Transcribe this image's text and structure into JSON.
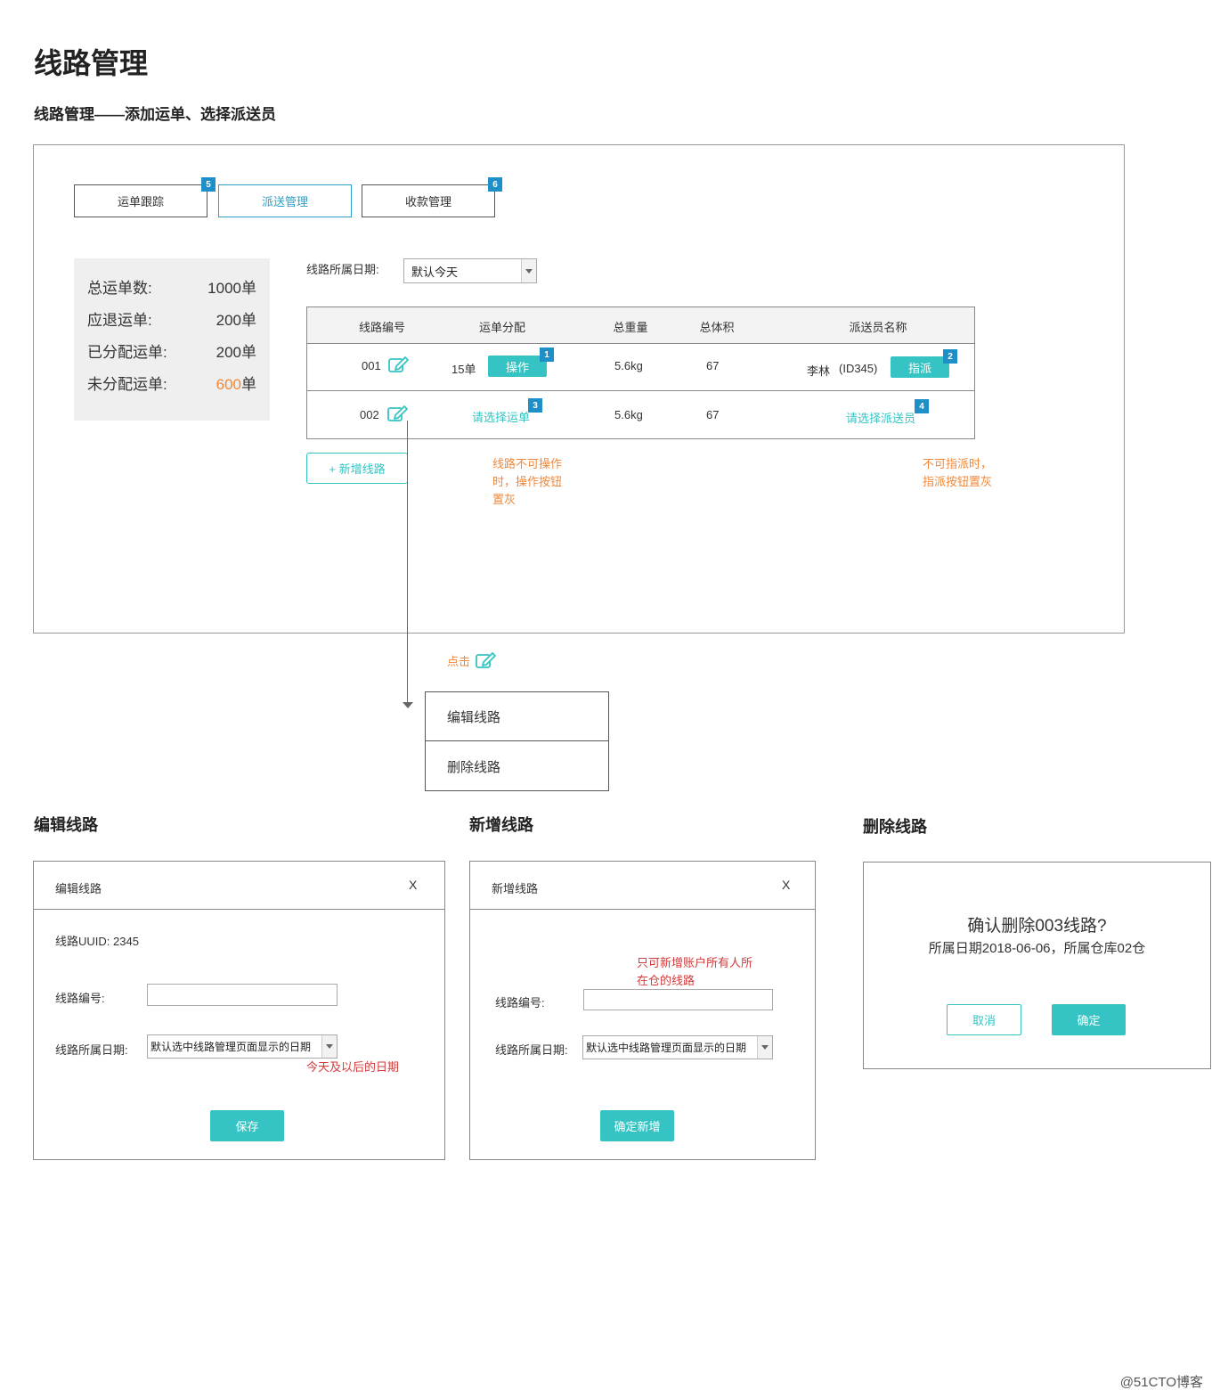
{
  "page": {
    "title": "线路管理",
    "subtitle": "线路管理——添加运单、选择派送员"
  },
  "tabs": [
    {
      "label": "运单跟踪",
      "badge": "5"
    },
    {
      "label": "派送管理",
      "badge": ""
    },
    {
      "label": "收款管理",
      "badge": "6"
    }
  ],
  "stats": [
    {
      "label": "总运单数:",
      "num": "1000",
      "unit": "单"
    },
    {
      "label": "应退运单:",
      "num": "200",
      "unit": "单"
    },
    {
      "label": "已分配运单:",
      "num": "200",
      "unit": "单"
    },
    {
      "label": "未分配运单:",
      "num": "600",
      "unit": "单"
    }
  ],
  "date_filter": {
    "label": "线路所属日期:",
    "value": "默认今天"
  },
  "table": {
    "headers": [
      "线路编号",
      "运单分配",
      "总重量",
      "总体积",
      "派送员名称"
    ],
    "rows": [
      {
        "id": "001",
        "count_num": "15",
        "count_unit": "单",
        "op_label": "操作",
        "op_badge": "1",
        "weight": "5.6kg",
        "volume": "67",
        "courier_name": "李林",
        "courier_id": "(ID345)",
        "assign_label": "指派",
        "assign_badge": "2"
      },
      {
        "id": "002",
        "choose_waybill": "请选择运单",
        "choose_badge": "3",
        "weight": "5.6kg",
        "volume": "67",
        "choose_courier": "请选择派送员",
        "courier_badge": "4"
      }
    ]
  },
  "add_route_label": "+ 新增线路",
  "notes": {
    "op_disabled": [
      "线路不可操作",
      "时，操作按钮",
      "置灰"
    ],
    "assign_disabled": [
      "不可指派时，",
      "指派按钮置灰"
    ],
    "click_hint": "点击"
  },
  "context_menu": [
    "编辑线路",
    "删除线路"
  ],
  "edit_dialog": {
    "section": "编辑线路",
    "title": "编辑线路",
    "close": "X",
    "uuid": "线路UUID: 2345",
    "route_no_label": "线路编号:",
    "date_label": "线路所属日期:",
    "date_value": "默认选中线路管理页面显示的日期",
    "date_note": "今天及以后的日期",
    "save_label": "保存"
  },
  "add_dialog": {
    "section": "新增线路",
    "title": "新增线路",
    "close": "X",
    "note": [
      "只可新增账户所有人所",
      "在仓的线路"
    ],
    "route_no_label": "线路编号:",
    "date_label": "线路所属日期:",
    "date_value": "默认选中线路管理页面显示的日期",
    "confirm_label": "确定新增"
  },
  "delete_dialog": {
    "section": "删除线路",
    "question": "确认删除003线路?",
    "detail": "所属日期2018-06-06，所属仓库02仓",
    "cancel_label": "取消",
    "confirm_label": "确定"
  },
  "watermark": "@51CTO博客",
  "colors": {
    "teal": "#35c3c3",
    "orange": "#f0883b",
    "red": "#d23b3b",
    "badge_blue": "#1f8fc8",
    "tab_active": "#2b9fc6"
  }
}
